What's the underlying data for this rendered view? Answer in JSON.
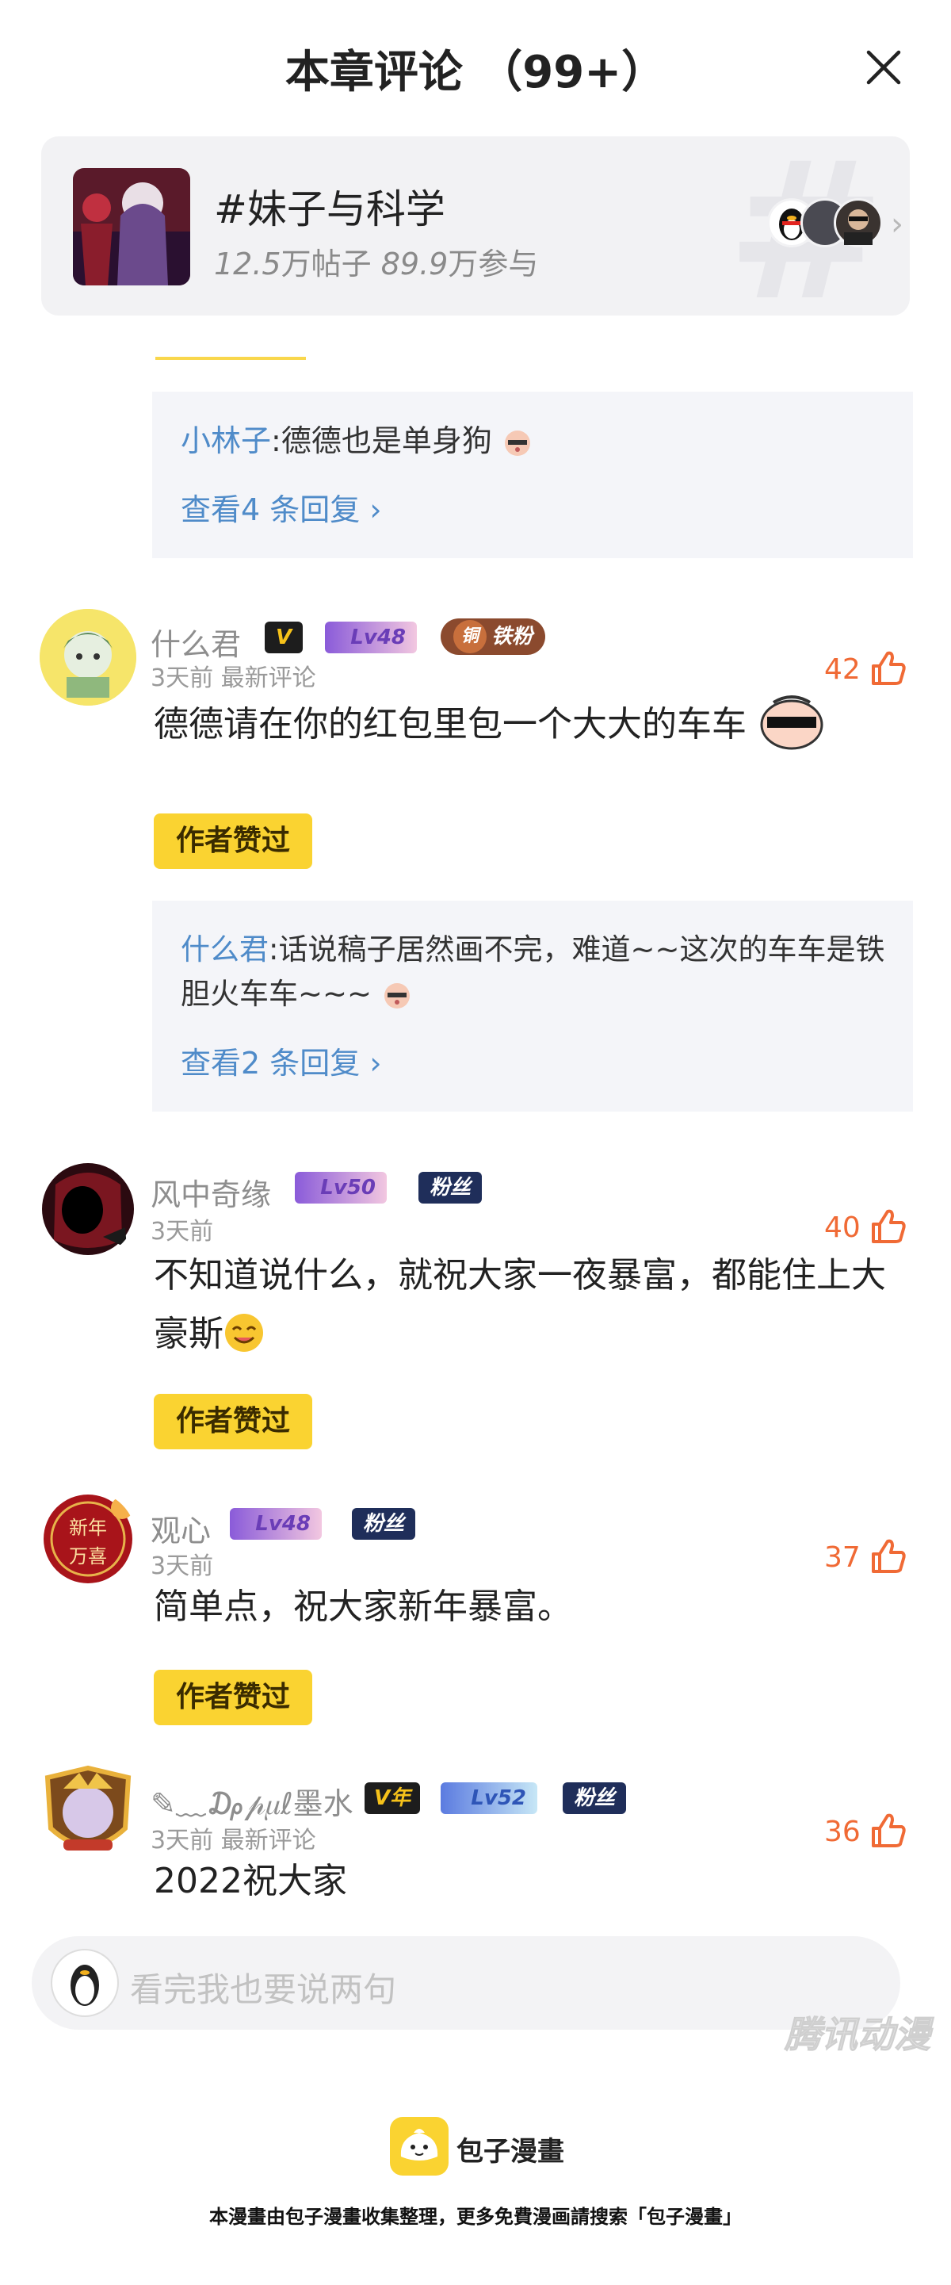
{
  "header": {
    "title": "本章评论 （99+）"
  },
  "topic": {
    "name": "#妹子与科学",
    "posts_num": "12.5",
    "posts_unit": "万帖子",
    "participants_num": "89.9",
    "participants_unit": "万参与"
  },
  "reply_box_1": {
    "user": "小林子",
    "text": ":德德也是单身狗",
    "more": "查看4 条回复 ›"
  },
  "comments": [
    {
      "user": "什么君",
      "vip": "V",
      "level": "Lv48",
      "fan_badge": "铁粉",
      "fan_badge_icon": "铜",
      "time": "3天前 最新评论",
      "likes": "42",
      "text": "德德请在你的红包里包一个大大的车车",
      "author_liked": "作者赞过",
      "reply_user": "什么君",
      "reply_text": ":话说稿子居然画不完，难道~~这次的车车是铁胆火车车~~~",
      "reply_more": "查看2 条回复 ›"
    },
    {
      "user": "风中奇缘",
      "level": "Lv50",
      "fan_badge": "粉丝",
      "time": "3天前",
      "likes": "40",
      "text": "不知道说什么，就祝大家一夜暴富，都能住上大豪斯",
      "author_liked": "作者赞过"
    },
    {
      "user": "观心",
      "level": "Lv48",
      "fan_badge": "粉丝",
      "time": "3天前",
      "likes": "37",
      "text": "简单点，祝大家新年暴富。",
      "author_liked": "作者赞过",
      "avatar_text_1": "新年",
      "avatar_text_2": "万喜"
    },
    {
      "user": "✎﹏₯𝓅𝜇ℓ墨水",
      "vip": "V年",
      "level": "Lv52",
      "fan_badge": "粉丝",
      "time": "3天前 最新评论",
      "likes": "36",
      "text": "2022祝大家"
    }
  ],
  "input": {
    "placeholder": "看完我也要说两句"
  },
  "watermark": "腾讯动漫",
  "footer": {
    "brand": "包子漫畫",
    "note": "本漫畫由包子漫畫收集整理，更多免費漫画請搜索「包子漫畫」"
  },
  "colors": {
    "accent_yellow": "#fad331",
    "link_blue": "#4f8bc9",
    "like_orange": "#f06a35"
  }
}
